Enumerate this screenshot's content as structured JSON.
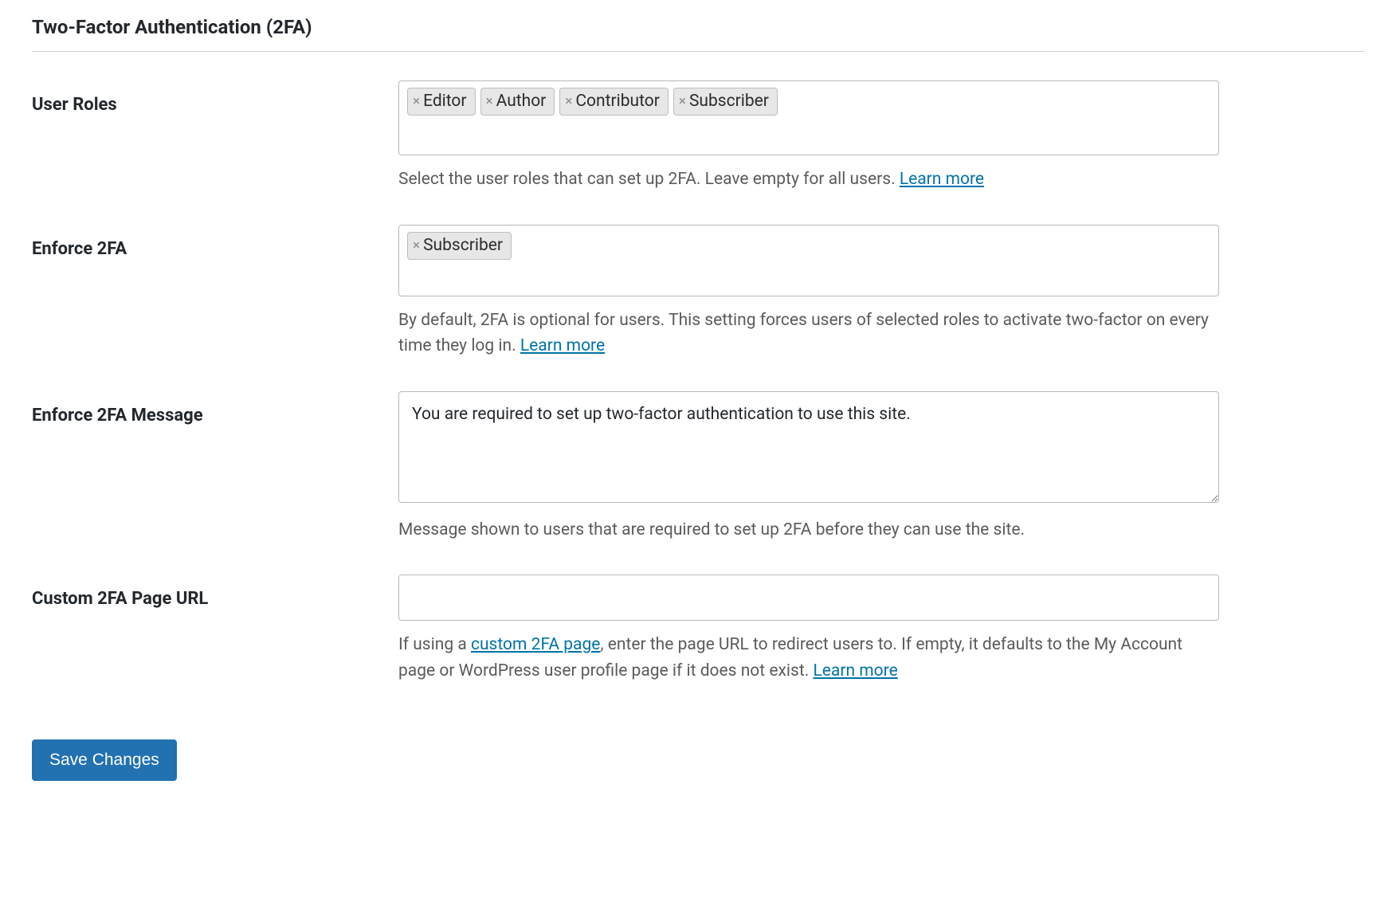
{
  "section": {
    "title": "Two-Factor Authentication (2FA)"
  },
  "fields": {
    "user_roles": {
      "label": "User Roles",
      "tags": [
        "Editor",
        "Author",
        "Contributor",
        "Subscriber"
      ],
      "description_pre": "Select the user roles that can set up 2FA. Leave empty for all users. ",
      "learn_more": "Learn more"
    },
    "enforce_2fa": {
      "label": "Enforce 2FA",
      "tags": [
        "Subscriber"
      ],
      "description_pre": "By default, 2FA is optional for users. This setting forces users of selected roles to activate two-factor on every time they log in. ",
      "learn_more": "Learn more"
    },
    "enforce_message": {
      "label": "Enforce 2FA Message",
      "value": "You are required to set up two-factor authentication to use this site.",
      "description": "Message shown to users that are required to set up 2FA before they can use the site."
    },
    "custom_url": {
      "label": "Custom 2FA Page URL",
      "value": "",
      "description_pre": "If using a ",
      "link_text": "custom 2FA page",
      "description_mid": ", enter the page URL to redirect users to. If empty, it defaults to the My Account page or WordPress user profile page if it does not exist. ",
      "learn_more": "Learn more"
    }
  },
  "buttons": {
    "save": "Save Changes"
  }
}
